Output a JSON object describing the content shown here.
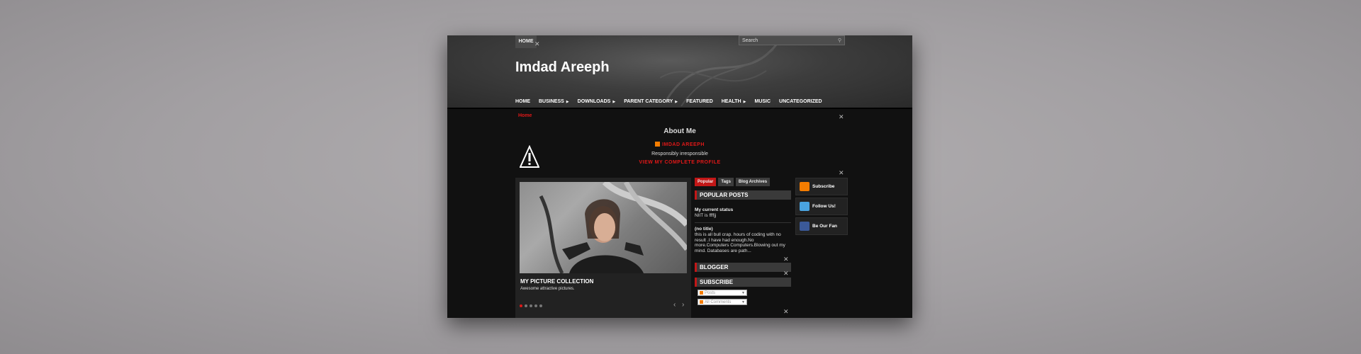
{
  "header": {
    "top_nav_home": "HOME",
    "search_placeholder": "Search",
    "site_title": "Imdad Areeph"
  },
  "nav": {
    "items": [
      {
        "label": "HOME",
        "has_submenu": false
      },
      {
        "label": "BUSINESS",
        "has_submenu": true
      },
      {
        "label": "DOWNLOADS",
        "has_submenu": true
      },
      {
        "label": "PARENT CATEGORY",
        "has_submenu": true
      },
      {
        "label": "FEATURED",
        "has_submenu": false
      },
      {
        "label": "HEALTH",
        "has_submenu": true
      },
      {
        "label": "MUSIC",
        "has_submenu": false
      },
      {
        "label": "UNCATEGORIZED",
        "has_submenu": false
      }
    ]
  },
  "breadcrumb": "Home",
  "about": {
    "title": "About Me",
    "name": "IMDAD AREEPH",
    "tagline": "Responsibly irresponsible",
    "profile_link": "VIEW MY COMPLETE PROFILE"
  },
  "slider": {
    "caption_title": "MY PICTURE COLLECTION",
    "caption_text": "Awesome attractive pictures.",
    "dot_count": 5,
    "active_index": 0
  },
  "sidebar": {
    "tabs": [
      {
        "label": "Popular",
        "active": true
      },
      {
        "label": "Tags",
        "active": false
      },
      {
        "label": "Blog Archives",
        "active": false
      }
    ],
    "popular_heading": "POPULAR POSTS",
    "posts": [
      {
        "title": "My current status",
        "text": "NIIT is ffffjj"
      },
      {
        "title": "(no title)",
        "text": "this is all bull crap. hours of coding with no result .I have had enough.No more.Computers Computers.Blowing out my mind. Databases are path..."
      }
    ],
    "blogger_heading": "BLOGGER",
    "subscribe_heading": "SUBSCRIBE",
    "subscribe_options": [
      {
        "label": "Posts"
      },
      {
        "label": "All Comments"
      }
    ]
  },
  "social": {
    "items": [
      {
        "label": "Subscribe",
        "icon": "rss-icon"
      },
      {
        "label": "Follow Us!",
        "icon": "twitter-icon"
      },
      {
        "label": "Be Our Fan",
        "icon": "facebook-icon"
      }
    ]
  },
  "colors": {
    "accent_red": "#e01818",
    "tab_red": "#c21717",
    "rss_orange": "#f57d00",
    "twitter_blue": "#4aa3df",
    "facebook_blue": "#3b5998"
  }
}
